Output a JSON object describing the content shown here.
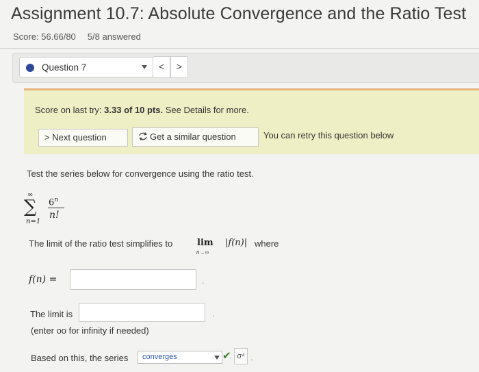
{
  "assignment": {
    "title": "Assignment 10.7: Absolute Convergence and the Ratio Test",
    "score": "Score: 56.66/80",
    "answered": "5/8 answered"
  },
  "question_nav": {
    "selected": "Question 7",
    "prev_symbol": "<",
    "next_symbol": ">"
  },
  "last_try": {
    "prefix": "Score on last try: ",
    "score": "3.33 of 10 pts.",
    "suffix": " See Details for more.",
    "next_button": "> Next question",
    "similar_button": "Get a similar question",
    "retry_text": "You can retry this question below"
  },
  "problem": {
    "prompt": "Test the series below for convergence using the ratio test.",
    "sum_upper": "∞",
    "sum_lower": "n=1",
    "numerator_base": "6",
    "numerator_exp": "n",
    "denominator": "n!",
    "limit_text": "The limit of the ratio test simplifies to",
    "lim": "lim",
    "lim_sub": "n→∞",
    "abs_expr": "|f(n)|",
    "where": "where",
    "f_label": "f(n) =",
    "f_value": "",
    "limit_label": "The limit is",
    "limit_value": "",
    "enter_note": "(enter oo for infinity if needed)",
    "based_text": "Based on this, the series",
    "series_result": "converges",
    "sig_symbol": "σ⁴"
  },
  "colors": {
    "accent_dot": "#2f4a9a",
    "yellow_panel": "#efefc6",
    "panel_border": "#e5b27a",
    "correct_check": "#3a7a2a"
  },
  "icons": {
    "prev": "chevron-left-icon",
    "next": "chevron-right-icon",
    "similar": "refresh-icon",
    "status": "checkmark-icon"
  }
}
